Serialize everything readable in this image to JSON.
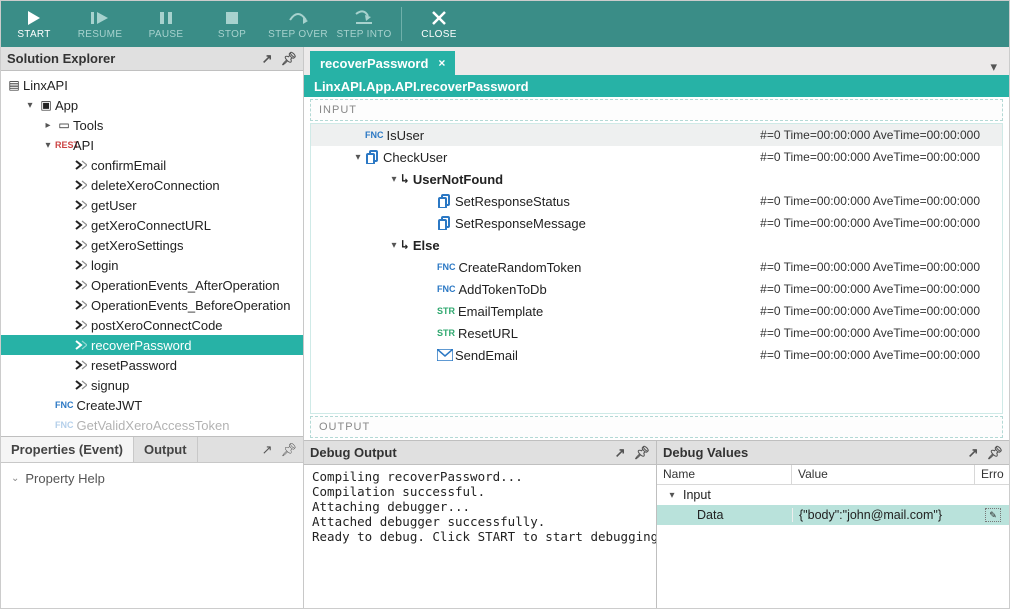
{
  "toolbar": {
    "start": "START",
    "resume": "RESUME",
    "pause": "PAUSE",
    "stop": "STOP",
    "step_over": "STEP OVER",
    "step_into": "STEP INTO",
    "close": "CLOSE"
  },
  "solution_explorer": {
    "title": "Solution Explorer",
    "root": "LinxAPI",
    "nodes": [
      {
        "label": "App",
        "depth": 1,
        "expanded": true,
        "icon": "project"
      },
      {
        "label": "Tools",
        "depth": 2,
        "expanded": false,
        "icon": "folder"
      },
      {
        "label": "API",
        "depth": 2,
        "expanded": true,
        "icon": "rest"
      },
      {
        "label": "confirmEmail",
        "depth": 3,
        "icon": "op"
      },
      {
        "label": "deleteXeroConnection",
        "depth": 3,
        "icon": "op"
      },
      {
        "label": "getUser",
        "depth": 3,
        "icon": "op"
      },
      {
        "label": "getXeroConnectURL",
        "depth": 3,
        "icon": "op"
      },
      {
        "label": "getXeroSettings",
        "depth": 3,
        "icon": "op"
      },
      {
        "label": "login",
        "depth": 3,
        "icon": "op"
      },
      {
        "label": "OperationEvents_AfterOperation",
        "depth": 3,
        "icon": "op"
      },
      {
        "label": "OperationEvents_BeforeOperation",
        "depth": 3,
        "icon": "op"
      },
      {
        "label": "postXeroConnectCode",
        "depth": 3,
        "icon": "op"
      },
      {
        "label": "recoverPassword",
        "depth": 3,
        "icon": "op",
        "selected": true
      },
      {
        "label": "resetPassword",
        "depth": 3,
        "icon": "op"
      },
      {
        "label": "signup",
        "depth": 3,
        "icon": "op"
      },
      {
        "label": "CreateJWT",
        "depth": 2,
        "icon": "fnc"
      },
      {
        "label": "GetValidXeroAccessToken",
        "depth": 2,
        "icon": "fnc",
        "overflow": true
      }
    ]
  },
  "properties": {
    "tab_properties": "Properties (Event)",
    "tab_output": "Output",
    "help_label": "Property Help"
  },
  "editor": {
    "tab_name": "recoverPassword",
    "path": "LinxAPI.App.API.recoverPassword",
    "input_label": "INPUT",
    "output_label": "OUTPUT",
    "stat_default": "#=0 Time=00:00:000 AveTime=00:00:000",
    "steps": [
      {
        "depth": 0,
        "badge": "FNC",
        "label": "IsUser",
        "selected": true,
        "stats": true
      },
      {
        "depth": 0,
        "twist": "open",
        "icon": "branch",
        "label": "CheckUser",
        "stats": true
      },
      {
        "depth": 1,
        "twist": "open",
        "arrow": true,
        "bold": true,
        "label": "UserNotFound"
      },
      {
        "depth": 2,
        "icon": "branch",
        "label": "SetResponseStatus",
        "stats": true
      },
      {
        "depth": 2,
        "icon": "branch",
        "label": "SetResponseMessage",
        "stats": true
      },
      {
        "depth": 1,
        "twist": "open",
        "arrow": true,
        "bold": true,
        "label": "Else"
      },
      {
        "depth": 2,
        "badge": "FNC",
        "label": "CreateRandomToken",
        "stats": true
      },
      {
        "depth": 2,
        "badge": "FNC",
        "label": "AddTokenToDb",
        "stats": true
      },
      {
        "depth": 2,
        "badge": "STR",
        "label": "EmailTemplate",
        "stats": true
      },
      {
        "depth": 2,
        "badge": "STR",
        "label": "ResetURL",
        "stats": true
      },
      {
        "depth": 2,
        "icon": "mail",
        "label": "SendEmail",
        "stats": true
      }
    ]
  },
  "debug_output": {
    "title": "Debug Output",
    "lines": "Compiling recoverPassword...\nCompilation successful.\nAttaching debugger...\nAttached debugger successfully.\nReady to debug. Click START to start debugging."
  },
  "debug_values": {
    "title": "Debug Values",
    "col_name": "Name",
    "col_value": "Value",
    "col_error": "Erro",
    "rows": [
      {
        "name": "Input",
        "expandable": true
      },
      {
        "name": "Data",
        "value": "{\"body\":\"john@mail.com\"}",
        "highlight": true,
        "editable": true
      }
    ]
  }
}
